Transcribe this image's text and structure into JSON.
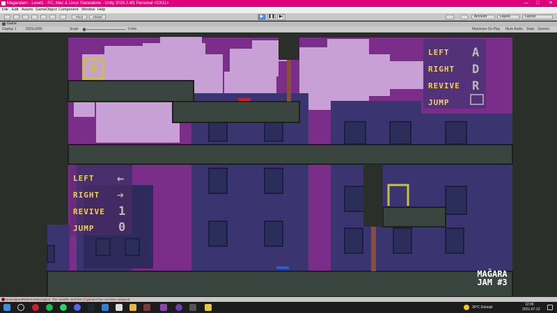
{
  "window": {
    "title": "Magaralam - Level1 - PC, Mac & Linux Standalone - Unity 2020.3.4f1 Personal <DX11>",
    "controls": {
      "minimize": "—",
      "maximize": "□",
      "close": "✕"
    }
  },
  "menu": [
    "File",
    "Edit",
    "Assets",
    "GameObject",
    "Component",
    "Window",
    "Help"
  ],
  "toolbar": {
    "pivot_label": "Pivot",
    "global_label": "Global",
    "account_label": "Account",
    "layers_label": "Layers",
    "layout_label": "Layout"
  },
  "game_tab": {
    "label": "Game"
  },
  "game_bar": {
    "display": "Display 1",
    "resolution": "1920x1080",
    "scale_label": "Scale",
    "scale_value": "0.44x",
    "maximize_on_play": "Maximize On Play",
    "mute_audio": "Mute Audio",
    "stats": "Stats",
    "gizmos": "Gizmos"
  },
  "game": {
    "p1_controls": {
      "left_label": "LEFT",
      "right_label": "RIGHT",
      "revive_label": "REVIVE",
      "jump_label": "JUMP",
      "left_key": "A",
      "right_key": "D",
      "revive_key": "R"
    },
    "p2_controls": {
      "left_label": "LEFT",
      "right_label": "RIGHT",
      "revive_label": "REVIVE",
      "jump_label": "JUMP",
      "left_key": "←",
      "right_key": "➔",
      "revive_key": "1",
      "jump_key": "0"
    },
    "logo": {
      "line1": "MAĞARA",
      "line2": "JAM #3"
    },
    "colors": {
      "sky": "#7a2e8a",
      "cloud": "#c9a0d6",
      "building": "#3a3570",
      "building_dark": "#2e2a5c",
      "ground": "#3b4540",
      "window": "#2b2e5a",
      "trunk": "#8a4d3a",
      "yellow": "#c8c23a",
      "red": "#e01818",
      "blue": "#1f5fe0"
    }
  },
  "status": {
    "message": "UnassignedReferenceException: The variable startText of gameUI has not been assigned."
  },
  "taskbar": {
    "weather": "30°C Güneşli",
    "time": "12:05",
    "date": "2021-07-12"
  }
}
